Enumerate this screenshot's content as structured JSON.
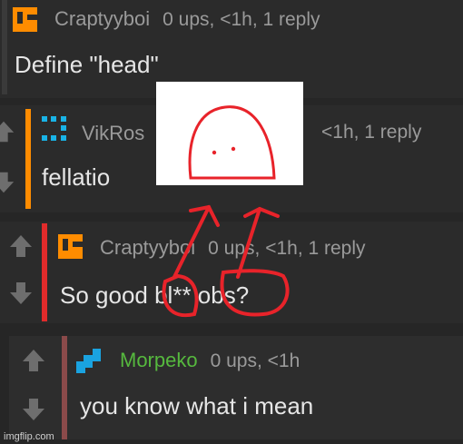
{
  "comments": [
    {
      "username": "Craptyyboi",
      "meta": "0 ups, <1h, 1 reply",
      "text": "Define \"head\"",
      "bar_color": "#ffffff"
    },
    {
      "username": "VikRos",
      "meta": "<1h, 1 reply",
      "text": "fellatio",
      "bar_color": "#ff8c00"
    },
    {
      "username": "Craptyyboi",
      "meta": "0 ups, <1h, 1 reply",
      "text": "So good bl** obs?",
      "bar_color": "#e12b2b"
    },
    {
      "username": "Morpeko",
      "meta": "0 ups, <1h",
      "text": "you know what i mean",
      "bar_color": "#8b4a4a"
    }
  ],
  "icons": {
    "upvote": "arrow-up-icon",
    "downvote": "arrow-down-icon"
  },
  "colors": {
    "orange_avatar": "#ff8c00",
    "cyan_avatar": "#19b3e6",
    "blue_avatar": "#1aa3e0",
    "annotation_red": "#e8232a"
  },
  "watermark": "imgflip.com"
}
